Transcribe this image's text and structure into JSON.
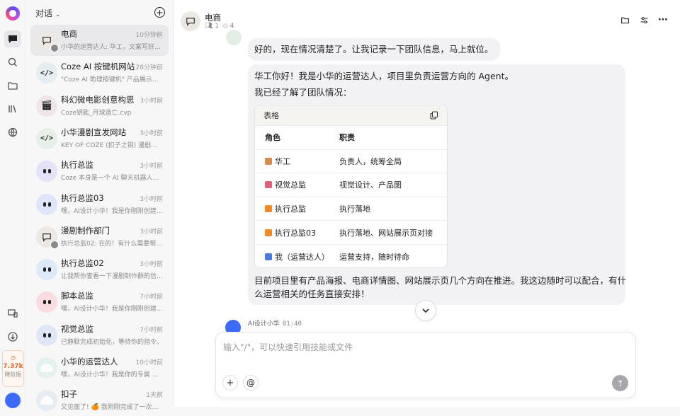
{
  "sidebar": {
    "header": "对话",
    "items": [
      {
        "title": "电商",
        "time": "10分钟前",
        "preview": "小华的运营达人: 华工，文案写好…",
        "bg": "#ece8e3",
        "icon": "chat-icon",
        "active": true
      },
      {
        "title": "Coze AI 按键机网站",
        "time": "28分钟前",
        "preview": "\"Coze AI 助理按键机\" 产品展示网…",
        "bg": "#e6edf0",
        "icon": "code-icon"
      },
      {
        "title": "科幻微电影创意构思",
        "time": "3小时前",
        "preview": "Coze钥匙_月球造亡.cvp",
        "bg": "#f0e6ea",
        "icon": "clapper-icon"
      },
      {
        "title": "小华漫剧宣发网站",
        "time": "3小时前",
        "preview": "KEY OF COZE (扣子之钥) 漫剧宣发…",
        "bg": "#e6f0e8",
        "icon": "code-icon"
      },
      {
        "title": "执行总监",
        "time": "3小时前",
        "preview": "Coze 本身是一个 AI 聊天机器人平…",
        "bg": "#e4e2f8",
        "icon": "eyes"
      },
      {
        "title": "执行总监03",
        "time": "3小时前",
        "preview": "嘿，AI设计小华！我是你刚刚创建…",
        "bg": "#dfe6fb",
        "icon": "eyes"
      },
      {
        "title": "漫剧制作部门",
        "time": "3小时前",
        "preview": "执行总监02: 在的！有什么需要帮…",
        "bg": "#ece8e3",
        "icon": "chat-icon"
      },
      {
        "title": "执行总监02",
        "time": "3小时前",
        "preview": "让我帮你查看一下漫剧制作群的信…",
        "bg": "#dceaf8",
        "icon": "eyes"
      },
      {
        "title": "脚本总监",
        "time": "7小时前",
        "preview": "嘿，AI设计小华！我是你刚刚创建…",
        "bg": "#fadbe0",
        "icon": "eyes"
      },
      {
        "title": "视觉总监",
        "time": "7小时前",
        "preview": "已静默完成初始化，等待你的指令。",
        "bg": "#dfe6f6",
        "icon": "eyes"
      },
      {
        "title": "小华的运营达人",
        "time": "10小时前",
        "preview": "嘿，AI设计小华！我是你的专属 自…",
        "bg": "#e4f2ef",
        "icon": "ghost"
      },
      {
        "title": "扣子",
        "time": "1天前",
        "preview": "又见面了! 🍊 我刚刚完成了一次…",
        "bg": "#e6ecf2",
        "icon": "ghost"
      }
    ]
  },
  "rail": {
    "credits": "7.37k",
    "credits_label": "降阶版"
  },
  "chat": {
    "title": "电商",
    "members": "1",
    "bots": "4",
    "msg1": "好的，现在情况清楚了。让我记录一下团队信息，马上就位。",
    "msg2_line1": "华工你好！我是小华的运营达人，项目里负责运营方向的 Agent。",
    "msg2_line2": "我已经了解了团队情况：",
    "table_label": "表格",
    "table_headers": [
      "角色",
      "职责"
    ],
    "table_rows": [
      {
        "role": "华工",
        "duty": "负责人，统筹全局",
        "emoji_color": "#d98a4a"
      },
      {
        "role": "视觉总监",
        "duty": "视觉设计、产品图",
        "emoji_color": "#e0607a"
      },
      {
        "role": "执行总监",
        "duty": "执行落地",
        "emoji_color": "#f08a24"
      },
      {
        "role": "执行总监03",
        "duty": "执行落地、网站展示页对接",
        "emoji_color": "#f08a24"
      },
      {
        "role": "我（运营达人）",
        "duty": "运营支持，随时待命",
        "emoji_color": "#4a7ae0"
      }
    ],
    "msg2_line3": "目前项目里有产品海报、电商详情图、网站展示页几个方向在推进。我这边随时可以配合，有什",
    "msg2_line4": "么运营相关的任务直接安排！",
    "next_sender": "AI设计小华",
    "next_time": "01:40",
    "input_placeholder": "输入\"/\"，可以快速引用技能或文件"
  }
}
